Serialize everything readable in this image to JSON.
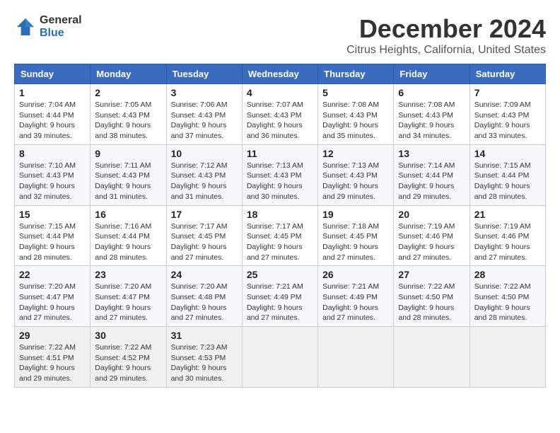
{
  "logo": {
    "general": "General",
    "blue": "Blue"
  },
  "title": "December 2024",
  "subtitle": "Citrus Heights, California, United States",
  "days_of_week": [
    "Sunday",
    "Monday",
    "Tuesday",
    "Wednesday",
    "Thursday",
    "Friday",
    "Saturday"
  ],
  "weeks": [
    [
      {
        "day": "1",
        "info": "Sunrise: 7:04 AM\nSunset: 4:44 PM\nDaylight: 9 hours\nand 39 minutes."
      },
      {
        "day": "2",
        "info": "Sunrise: 7:05 AM\nSunset: 4:43 PM\nDaylight: 9 hours\nand 38 minutes."
      },
      {
        "day": "3",
        "info": "Sunrise: 7:06 AM\nSunset: 4:43 PM\nDaylight: 9 hours\nand 37 minutes."
      },
      {
        "day": "4",
        "info": "Sunrise: 7:07 AM\nSunset: 4:43 PM\nDaylight: 9 hours\nand 36 minutes."
      },
      {
        "day": "5",
        "info": "Sunrise: 7:08 AM\nSunset: 4:43 PM\nDaylight: 9 hours\nand 35 minutes."
      },
      {
        "day": "6",
        "info": "Sunrise: 7:08 AM\nSunset: 4:43 PM\nDaylight: 9 hours\nand 34 minutes."
      },
      {
        "day": "7",
        "info": "Sunrise: 7:09 AM\nSunset: 4:43 PM\nDaylight: 9 hours\nand 33 minutes."
      }
    ],
    [
      {
        "day": "8",
        "info": "Sunrise: 7:10 AM\nSunset: 4:43 PM\nDaylight: 9 hours\nand 32 minutes."
      },
      {
        "day": "9",
        "info": "Sunrise: 7:11 AM\nSunset: 4:43 PM\nDaylight: 9 hours\nand 31 minutes."
      },
      {
        "day": "10",
        "info": "Sunrise: 7:12 AM\nSunset: 4:43 PM\nDaylight: 9 hours\nand 31 minutes."
      },
      {
        "day": "11",
        "info": "Sunrise: 7:13 AM\nSunset: 4:43 PM\nDaylight: 9 hours\nand 30 minutes."
      },
      {
        "day": "12",
        "info": "Sunrise: 7:13 AM\nSunset: 4:43 PM\nDaylight: 9 hours\nand 29 minutes."
      },
      {
        "day": "13",
        "info": "Sunrise: 7:14 AM\nSunset: 4:44 PM\nDaylight: 9 hours\nand 29 minutes."
      },
      {
        "day": "14",
        "info": "Sunrise: 7:15 AM\nSunset: 4:44 PM\nDaylight: 9 hours\nand 28 minutes."
      }
    ],
    [
      {
        "day": "15",
        "info": "Sunrise: 7:15 AM\nSunset: 4:44 PM\nDaylight: 9 hours\nand 28 minutes."
      },
      {
        "day": "16",
        "info": "Sunrise: 7:16 AM\nSunset: 4:44 PM\nDaylight: 9 hours\nand 28 minutes."
      },
      {
        "day": "17",
        "info": "Sunrise: 7:17 AM\nSunset: 4:45 PM\nDaylight: 9 hours\nand 27 minutes."
      },
      {
        "day": "18",
        "info": "Sunrise: 7:17 AM\nSunset: 4:45 PM\nDaylight: 9 hours\nand 27 minutes."
      },
      {
        "day": "19",
        "info": "Sunrise: 7:18 AM\nSunset: 4:45 PM\nDaylight: 9 hours\nand 27 minutes."
      },
      {
        "day": "20",
        "info": "Sunrise: 7:19 AM\nSunset: 4:46 PM\nDaylight: 9 hours\nand 27 minutes."
      },
      {
        "day": "21",
        "info": "Sunrise: 7:19 AM\nSunset: 4:46 PM\nDaylight: 9 hours\nand 27 minutes."
      }
    ],
    [
      {
        "day": "22",
        "info": "Sunrise: 7:20 AM\nSunset: 4:47 PM\nDaylight: 9 hours\nand 27 minutes."
      },
      {
        "day": "23",
        "info": "Sunrise: 7:20 AM\nSunset: 4:47 PM\nDaylight: 9 hours\nand 27 minutes."
      },
      {
        "day": "24",
        "info": "Sunrise: 7:20 AM\nSunset: 4:48 PM\nDaylight: 9 hours\nand 27 minutes."
      },
      {
        "day": "25",
        "info": "Sunrise: 7:21 AM\nSunset: 4:49 PM\nDaylight: 9 hours\nand 27 minutes."
      },
      {
        "day": "26",
        "info": "Sunrise: 7:21 AM\nSunset: 4:49 PM\nDaylight: 9 hours\nand 27 minutes."
      },
      {
        "day": "27",
        "info": "Sunrise: 7:22 AM\nSunset: 4:50 PM\nDaylight: 9 hours\nand 28 minutes."
      },
      {
        "day": "28",
        "info": "Sunrise: 7:22 AM\nSunset: 4:50 PM\nDaylight: 9 hours\nand 28 minutes."
      }
    ],
    [
      {
        "day": "29",
        "info": "Sunrise: 7:22 AM\nSunset: 4:51 PM\nDaylight: 9 hours\nand 29 minutes."
      },
      {
        "day": "30",
        "info": "Sunrise: 7:22 AM\nSunset: 4:52 PM\nDaylight: 9 hours\nand 29 minutes."
      },
      {
        "day": "31",
        "info": "Sunrise: 7:23 AM\nSunset: 4:53 PM\nDaylight: 9 hours\nand 30 minutes."
      },
      {
        "day": "",
        "info": ""
      },
      {
        "day": "",
        "info": ""
      },
      {
        "day": "",
        "info": ""
      },
      {
        "day": "",
        "info": ""
      }
    ]
  ]
}
